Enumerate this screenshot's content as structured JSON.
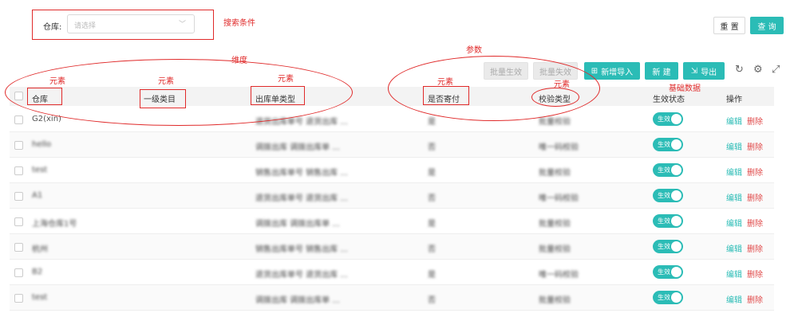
{
  "search": {
    "label": "仓库:",
    "placeholder": "请选择",
    "reset_label": "重 置",
    "query_label": "查 询"
  },
  "toolbar": {
    "batch_enable": "批量生效",
    "batch_disable": "批量失效",
    "import_label": "新增导入",
    "new_label": "新 建",
    "export_label": "导出"
  },
  "table": {
    "columns": [
      "仓库",
      "一级类目",
      "出库单类型",
      "是否寄付",
      "校验类型",
      "生效状态",
      "操作"
    ],
    "rows": [
      {
        "warehouse": "G2(xin)",
        "category": "",
        "outbound": "退货出库单号 退货出库 ...",
        "deposit": "是",
        "check": "批量校验"
      },
      {
        "warehouse": "hello",
        "category": "",
        "outbound": "调拨出库 调拨出库单 ...",
        "deposit": "否",
        "check": "唯一码校验"
      },
      {
        "warehouse": "test",
        "category": "",
        "outbound": "销售出库单号 销售出库 ...",
        "deposit": "是",
        "check": "批量校验"
      },
      {
        "warehouse": "A1",
        "category": "",
        "outbound": "退货出库单号 退货出库 ...",
        "deposit": "否",
        "check": "唯一码校验"
      },
      {
        "warehouse": "上海仓库1号",
        "category": "",
        "outbound": "调拨出库 调拨出库单 ...",
        "deposit": "是",
        "check": "批量校验"
      },
      {
        "warehouse": "杭州",
        "category": "",
        "outbound": "销售出库单号 销售出库 ...",
        "deposit": "否",
        "check": "批量校验"
      },
      {
        "warehouse": "B2",
        "category": "",
        "outbound": "退货出库单号 退货出库 ...",
        "deposit": "是",
        "check": "唯一码校验"
      },
      {
        "warehouse": "test",
        "category": "",
        "outbound": "调拨出库 调拨出库单 ...",
        "deposit": "否",
        "check": "批量校验"
      }
    ],
    "status_label": "生效",
    "edit_label": "编辑",
    "delete_label": "删除"
  },
  "annotations": {
    "search_conditions": "搜索条件",
    "dimension": "维度",
    "params": "参数",
    "element": "元素",
    "base_data": "基础数据"
  },
  "colors": {
    "primary": "#2bbcb6",
    "annotation": "#e02a2a",
    "danger": "#e04a4a"
  }
}
